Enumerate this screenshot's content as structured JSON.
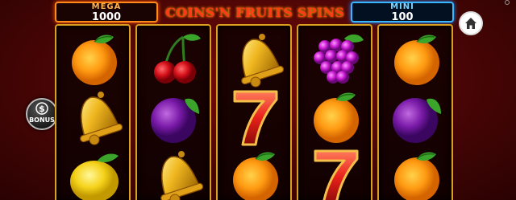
{
  "jackpots": {
    "mega": {
      "label": "MEGA",
      "value": "1000"
    },
    "mini": {
      "label": "MINI",
      "value": "100"
    }
  },
  "title": "COINS'N FRUITS SPINS",
  "buttons": {
    "bonus_label": "BONUS",
    "home_icon": "home-icon"
  },
  "reels": [
    [
      "orange",
      "bell",
      "lemon"
    ],
    [
      "cherry",
      "plum",
      "bell"
    ],
    [
      "bell",
      "seven",
      "orange"
    ],
    [
      "grapes",
      "orange",
      "seven"
    ],
    [
      "orange",
      "plum",
      "orange"
    ]
  ],
  "colors": {
    "reel_border": "#d9a020",
    "mega_accent": "#ff8a1a",
    "mini_accent": "#3ab6ff",
    "title": "#ff3a1a"
  }
}
